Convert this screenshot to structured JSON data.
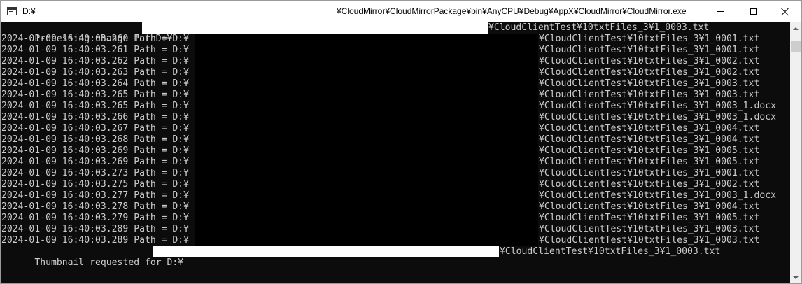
{
  "window": {
    "title_left": "D:¥",
    "title_right": "¥CloudMirror¥CloudMirrorPackage¥bin¥AnyCPU¥Debug¥AppX¥CloudMirror¥CloudMirror.exe"
  },
  "console": {
    "header": {
      "prefix": "Processing change for D:¥",
      "suffix": "¥CloudClientTest¥10txtFiles_3¥1_0003.txt"
    },
    "path_label": " Path = D:¥",
    "rows": [
      {
        "timestamp": "2024-01-09 16:40:03.260",
        "file": "¥CloudClientTest¥10txtFiles_3¥1_0001.txt"
      },
      {
        "timestamp": "2024-01-09 16:40:03.261",
        "file": "¥CloudClientTest¥10txtFiles_3¥1_0001.txt"
      },
      {
        "timestamp": "2024-01-09 16:40:03.262",
        "file": "¥CloudClientTest¥10txtFiles_3¥1_0002.txt"
      },
      {
        "timestamp": "2024-01-09 16:40:03.263",
        "file": "¥CloudClientTest¥10txtFiles_3¥1_0002.txt"
      },
      {
        "timestamp": "2024-01-09 16:40:03.264",
        "file": "¥CloudClientTest¥10txtFiles_3¥1_0003.txt"
      },
      {
        "timestamp": "2024-01-09 16:40:03.265",
        "file": "¥CloudClientTest¥10txtFiles_3¥1_0003.txt"
      },
      {
        "timestamp": "2024-01-09 16:40:03.265",
        "file": "¥CloudClientTest¥10txtFiles_3¥1_0003_1.docx"
      },
      {
        "timestamp": "2024-01-09 16:40:03.266",
        "file": "¥CloudClientTest¥10txtFiles_3¥1_0003_1.docx"
      },
      {
        "timestamp": "2024-01-09 16:40:03.267",
        "file": "¥CloudClientTest¥10txtFiles_3¥1_0004.txt"
      },
      {
        "timestamp": "2024-01-09 16:40:03.268",
        "file": "¥CloudClientTest¥10txtFiles_3¥1_0004.txt"
      },
      {
        "timestamp": "2024-01-09 16:40:03.269",
        "file": "¥CloudClientTest¥10txtFiles_3¥1_0005.txt"
      },
      {
        "timestamp": "2024-01-09 16:40:03.269",
        "file": "¥CloudClientTest¥10txtFiles_3¥1_0005.txt"
      },
      {
        "timestamp": "2024-01-09 16:40:03.273",
        "file": "¥CloudClientTest¥10txtFiles_3¥1_0001.txt"
      },
      {
        "timestamp": "2024-01-09 16:40:03.275",
        "file": "¥CloudClientTest¥10txtFiles_3¥1_0002.txt"
      },
      {
        "timestamp": "2024-01-09 16:40:03.277",
        "file": "¥CloudClientTest¥10txtFiles_3¥1_0003_1.docx"
      },
      {
        "timestamp": "2024-01-09 16:40:03.278",
        "file": "¥CloudClientTest¥10txtFiles_3¥1_0004.txt"
      },
      {
        "timestamp": "2024-01-09 16:40:03.279",
        "file": "¥CloudClientTest¥10txtFiles_3¥1_0005.txt"
      },
      {
        "timestamp": "2024-01-09 16:40:03.289",
        "file": "¥CloudClientTest¥10txtFiles_3¥1_0003.txt"
      },
      {
        "timestamp": "2024-01-09 16:40:03.289",
        "file": "¥CloudClientTest¥10txtFiles_3¥1_0003.txt"
      }
    ],
    "footer": {
      "prefix": "Thumbnail requested for D:¥",
      "suffix": "¥CloudClientTest¥10txtFiles_3¥1_0003.txt"
    }
  },
  "colors": {
    "console_bg": "#0c0c0c",
    "console_text": "#cccccc",
    "redaction_white": "#ffffff",
    "redaction_black": "#000000"
  },
  "icons": {
    "app": "console-app-icon",
    "minimize": "minimize-icon",
    "maximize": "maximize-icon",
    "close": "close-icon",
    "scroll_up": "scroll-up-arrow-icon",
    "scroll_down": "scroll-down-arrow-icon"
  }
}
